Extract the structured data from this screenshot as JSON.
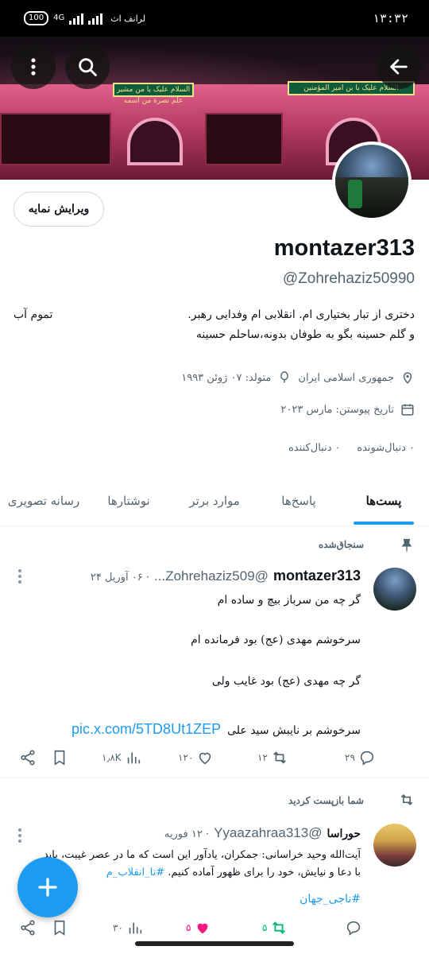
{
  "status_bar": {
    "time": "۱۳:۳۲",
    "battery": "100",
    "network": "4G",
    "carrier": "لرانف اث"
  },
  "banner": {
    "sign_left": "السلام علیک یا من مشیر علم نصرة من اسمه",
    "sign_right": "السلام علیک یا بن امیر المؤمنین"
  },
  "header_buttons": {
    "back_icon": "arrow-left-icon",
    "search_icon": "search-icon",
    "more_icon": "more-vertical-icon"
  },
  "profile": {
    "edit_label": "ویرایش نمایه",
    "name": "montazer313",
    "handle": "@Zohrehaziz50990",
    "bio_line1": "دختری از تبار بختیاری ام. انقلابی ام وفدایی رهبر.",
    "bio_line2": "و گلم حسینه  بگو به طوفان بدونه،ساحلم حسینه",
    "bio_extra": "تموم آب",
    "location": "جمهوری اسلامی ایران",
    "birthday": "متولد: ۰۷ ژوئن ۱۹۹۳",
    "joined": "تاریخ پیوستن: مارس ۲۰۲۳",
    "following": "۰ دنبال‌شونده",
    "followers": "۰ دنبال‌کننده"
  },
  "tabs": [
    {
      "label": "پست‌ها",
      "active": true
    },
    {
      "label": "پاسخ‌ها",
      "active": false
    },
    {
      "label": "موارد برتر",
      "active": false
    },
    {
      "label": "نوشتارها",
      "active": false
    },
    {
      "label": "رسانه تصویری",
      "active": false
    }
  ],
  "pinned_post": {
    "context": "سنجاق‌شده",
    "name": "montazer313",
    "handle": "@Zohrehaziz509...",
    "date": "· ۰۶ آوریل ۲۴",
    "lines": [
      "گر چه من سرباز بیچ و ساده ام",
      "سرخوشم مهدی (عج) بود فرمانده ام",
      "گر چه مهدی (عج) بود غایب ولی",
      "سرخوشم بر نایبش سید علی"
    ],
    "link": "pic.x.com/5TD8Ut1ZEP",
    "replies": "۲۹",
    "reposts": "۱۲",
    "likes": "۱۲۰",
    "views": "۱٫۸K"
  },
  "repost": {
    "context": "شما بازپست کردید",
    "name": "حوراسا",
    "handle": "@Yyaazahraa313",
    "date": "· ۱۲ فوریه",
    "line1": "آیت‌الله وحید خراسانی: جمکران، یادآور این است که ما در عصر غیبت، باید",
    "line2": "با دعا و نیایش، خود را برای ظهور آماده کنیم.",
    "hashtag1": "#تا_انقلاب_م",
    "hashtag2": "#ناجی_جهان",
    "reposts": "۵",
    "likes": "۵",
    "views": "۳۰"
  },
  "colors": {
    "accent": "#1d9bf0",
    "like": "#f91880",
    "repost": "#00ba7c"
  }
}
